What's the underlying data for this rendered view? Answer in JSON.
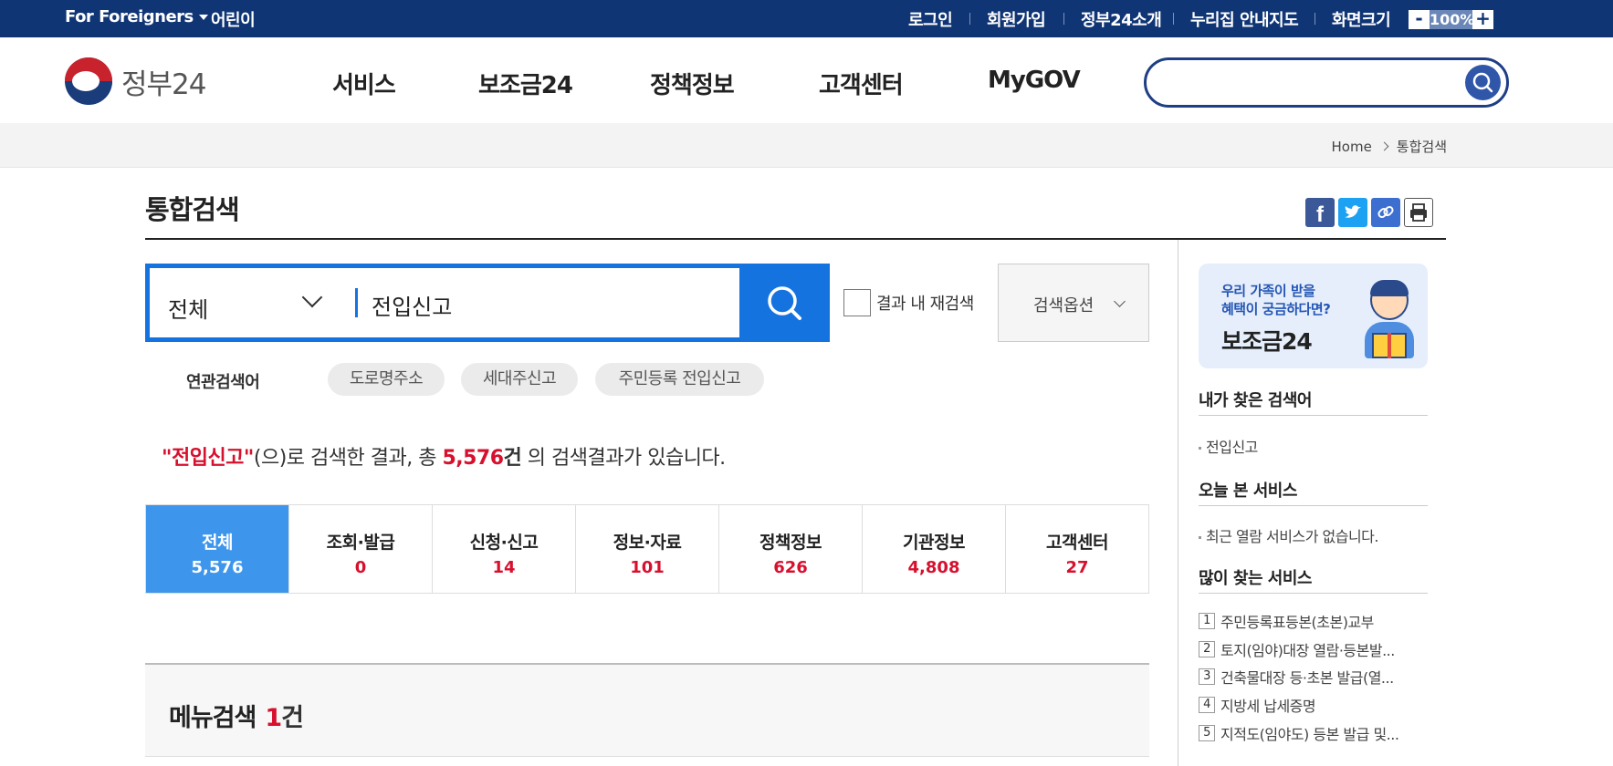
{
  "topbar": {
    "foreigners": "For Foreigners",
    "kids": "어린이",
    "login": "로그인",
    "signup": "회원가입",
    "about": "정부24소개",
    "sitemap": "누리집 안내지도",
    "screen_size": "화면크기",
    "zoom_minus": "-",
    "zoom_value": "100%",
    "zoom_plus": "+"
  },
  "header": {
    "logo_text": "정부24",
    "nav": [
      "서비스",
      "보조금24",
      "정책정보",
      "고객센터",
      "MyGOV"
    ],
    "search_placeholder": ""
  },
  "breadcrumb": {
    "home": "Home",
    "current": "통합검색"
  },
  "page": {
    "title": "통합검색"
  },
  "search": {
    "scope": "전체",
    "query": "전입신고",
    "recheck_label": "결과 내 재검색",
    "options_label": "검색옵션"
  },
  "related": {
    "label": "연관검색어",
    "chips": [
      "도로명주소",
      "세대주신고",
      "주민등록 전입신고"
    ]
  },
  "result": {
    "keyword": "\"전입신고\"",
    "text1": "(으)로 검색한 결과, 총 ",
    "total": "5,576",
    "unit": "건",
    "text2": " 의 검색결과가 있습니다."
  },
  "tabs": [
    {
      "label": "전체",
      "count": "5,576"
    },
    {
      "label": "조회·발급",
      "count": "0"
    },
    {
      "label": "신청·신고",
      "count": "14"
    },
    {
      "label": "정보·자료",
      "count": "101"
    },
    {
      "label": "정책정보",
      "count": "626"
    },
    {
      "label": "기관정보",
      "count": "4,808"
    },
    {
      "label": "고객센터",
      "count": "27"
    }
  ],
  "menu_section": {
    "title": "메뉴검색",
    "count": "1",
    "unit": "건"
  },
  "sidebar": {
    "banner_line1": "우리 가족이 받을",
    "banner_line2": "혜택이 궁금하다면?",
    "banner_title": "보조금24",
    "my_searches_title": "내가 찾은 검색어",
    "my_searches": [
      "전입신고"
    ],
    "today_title": "오늘 본 서비스",
    "today_empty": "최근 열람 서비스가 없습니다.",
    "popular_title": "많이 찾는 서비스",
    "popular": [
      {
        "num": "1",
        "label": "주민등록표등본(초본)교부"
      },
      {
        "num": "2",
        "label": "토지(임야)대장 열람·등본발..."
      },
      {
        "num": "3",
        "label": "건축물대장 등·초본 발급(열..."
      },
      {
        "num": "4",
        "label": "지방세 납세증명"
      },
      {
        "num": "5",
        "label": "지적도(임야도) 등본 발급 및..."
      }
    ]
  },
  "colors": {
    "topbar": "#103575",
    "accent_blue": "#1573e0",
    "active_tab": "#3d96ec",
    "highlight_red": "#d7102e"
  }
}
